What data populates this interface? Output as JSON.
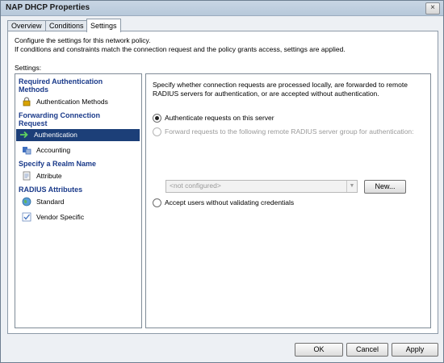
{
  "window": {
    "title": "NAP DHCP Properties",
    "close_glyph": "×"
  },
  "tabs": [
    {
      "label": "Overview",
      "active": false
    },
    {
      "label": "Conditions",
      "active": false
    },
    {
      "label": "Settings",
      "active": true
    }
  ],
  "panel": {
    "description_line1": "Configure the settings for this network policy.",
    "description_line2": "If conditions and constraints match the connection request and the policy grants access, settings are applied.",
    "settings_label": "Settings:"
  },
  "tree": {
    "sections": [
      {
        "heading_line1": "Required Authentication",
        "heading_line2": "Methods",
        "items": [
          {
            "label": "Authentication Methods",
            "icon": "lock-icon",
            "selected": false
          }
        ]
      },
      {
        "heading_line1": "Forwarding Connection",
        "heading_line2": "Request",
        "items": [
          {
            "label": "Authentication",
            "icon": "arrow-right-icon",
            "selected": true
          },
          {
            "label": "Accounting",
            "icon": "accounting-icon",
            "selected": false
          }
        ]
      },
      {
        "heading_line1": "Specify a Realm Name",
        "heading_line2": "",
        "items": [
          {
            "label": "Attribute",
            "icon": "document-icon",
            "selected": false
          }
        ]
      },
      {
        "heading_line1": "RADIUS Attributes",
        "heading_line2": "",
        "items": [
          {
            "label": "Standard",
            "icon": "globe-icon",
            "selected": false
          },
          {
            "label": "Vendor Specific",
            "icon": "checklist-icon",
            "selected": false
          }
        ]
      }
    ]
  },
  "right": {
    "description_line1": "Specify whether connection requests are processed locally, are forwarded to remote",
    "description_line2": "RADIUS servers for authentication, or are accepted without authentication.",
    "options": [
      {
        "label": "Authenticate requests on this server",
        "checked": true,
        "disabled": false
      },
      {
        "label": "Forward requests to the following remote RADIUS server group for authentication:",
        "checked": false,
        "disabled": true
      },
      {
        "label": "Accept users without validating credentials",
        "checked": false,
        "disabled": false
      }
    ],
    "server_group": {
      "value": "<not configured>",
      "disabled": true
    },
    "new_button": "New..."
  },
  "footer": {
    "ok": "OK",
    "cancel": "Cancel",
    "apply": "Apply"
  },
  "colors": {
    "selection": "#1c3f78",
    "heading": "#1a3a8a"
  }
}
